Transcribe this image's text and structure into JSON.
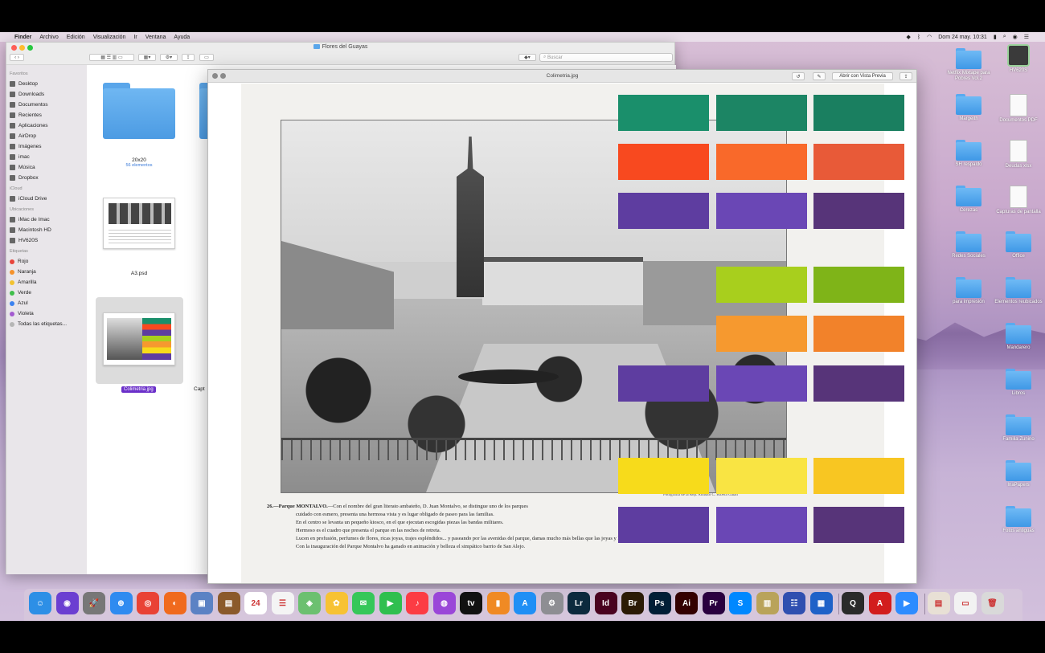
{
  "menubar": {
    "apple": "",
    "items": [
      "Finder",
      "Archivo",
      "Edición",
      "Visualización",
      "Ir",
      "Ventana",
      "Ayuda"
    ],
    "clock": "Dom 24 may.  10:31"
  },
  "finder": {
    "title": "Flores del Guayas",
    "search_placeholder": "Buscar",
    "sidebar": {
      "favorites_header": "Favoritos",
      "favorites": [
        "Desktop",
        "Downloads",
        "Documentos",
        "Recientes",
        "Aplicaciones",
        "AirDrop",
        "Imágenes",
        "imac",
        "Música",
        "Dropbox"
      ],
      "icloud_header": "iCloud",
      "icloud": [
        "iCloud Drive"
      ],
      "locations_header": "Ubicaciones",
      "locations": [
        "iMac de Imac",
        "Macintosh HD",
        "HV620S"
      ],
      "tags_header": "Etiquetas",
      "tags": [
        {
          "label": "Rojo",
          "color": "#e8453c"
        },
        {
          "label": "Naranja",
          "color": "#f5922b"
        },
        {
          "label": "Amarilla",
          "color": "#f2c230"
        },
        {
          "label": "Verde",
          "color": "#3fbe4b"
        },
        {
          "label": "Azul",
          "color": "#3a82f0"
        },
        {
          "label": "Violeta",
          "color": "#a35ad0"
        },
        {
          "label": "Todas las etiquetas...",
          "color": "#b5b5b5"
        }
      ]
    },
    "files": [
      {
        "name": "20x20",
        "sub": "56 elementos"
      },
      {
        "name": "A3.psd",
        "sub": ""
      },
      {
        "name": "Colimetria.jpg",
        "sub": ""
      },
      {
        "name": "Capt",
        "sub": ""
      }
    ]
  },
  "quicklook": {
    "title": "Colimetria.jpg",
    "open_with": "Abrir con Vista Previa",
    "caption": {
      "heading": "26.—Parque MONTALVO.",
      "line1": "—Con el nombre del gran literato ambateño, D. Juan Montalvo, se distingue uno de los parques",
      "line2": "cuidado con esmero, presenta una hermosa vista y es lugar obligado de paseo para las familias.",
      "line3": "En el centro se levanta un pequeño kiosco, en el que ejecutan escogidas piezas las bandas militares.",
      "line4": "Hermoso es el cuadro que presenta el parque en las noches de retreta.",
      "line5": "Lucen en profusión, perfumes de flores, ricas joyas, trajes espléndidos... y paseando por las avenidas del parque, damas mucho más bellas que las joyas y las flores.",
      "line6": "Con la inauguración del Parque Montalvo ha ganado en animación y belleza el simpático barrio de San Alejo."
    },
    "photo_credit": "Fotografía de la Rep. Ambato C. Ribera Galán",
    "swatches": [
      [
        "#1a8f6b",
        "#1c8564",
        "#1a7f60"
      ],
      [
        "#f8491f",
        "#f9692a",
        "#e85a38"
      ],
      [
        "#5e3da0",
        "#6a47b5",
        "#573479"
      ],
      [
        "",
        "#a8cf1d",
        "#7fb418"
      ],
      [
        "",
        "#f6992f",
        "#f2822a"
      ],
      [
        "#5e3da0",
        "#6a47b5",
        "#573479"
      ],
      [
        "#f7db1b",
        "#f9e443",
        "#f8c622"
      ],
      [
        "#5e3da0",
        "#6a47b5",
        "#573479"
      ]
    ]
  },
  "desktop_icons": [
    {
      "label": "Netflix Mixtape para Pobres Vol.2",
      "kind": "folder"
    },
    {
      "label": "HV620S",
      "kind": "drive"
    },
    {
      "label": "Margeith",
      "kind": "folder"
    },
    {
      "label": "Documentos PDF",
      "kind": "doc"
    },
    {
      "label": "SH respaldo",
      "kind": "folder"
    },
    {
      "label": "Deudas xlsx",
      "kind": "doc"
    },
    {
      "label": "Cerezas",
      "kind": "folder"
    },
    {
      "label": "Capturas de pantalla",
      "kind": "doc"
    },
    {
      "label": "Redes Sociales",
      "kind": "folder"
    },
    {
      "label": "Office",
      "kind": "folder"
    },
    {
      "label": "para impresión",
      "kind": "folder"
    },
    {
      "label": "Elementos reubicados",
      "kind": "folder"
    },
    {
      "label": "Mandarero",
      "kind": "folder"
    },
    {
      "label": "Libros",
      "kind": "folder"
    },
    {
      "label": "Familia Zunino",
      "kind": "folder"
    },
    {
      "label": "InaPapers",
      "kind": "folder"
    },
    {
      "label": "Fotos antiguas",
      "kind": "folder"
    }
  ],
  "dock": [
    {
      "name": "finder-icon",
      "glyph": "☺",
      "color": "#2d8fe6"
    },
    {
      "name": "siri-icon",
      "glyph": "◉",
      "color": "#6b3fd1"
    },
    {
      "name": "launchpad-icon",
      "glyph": "🚀",
      "color": "#777"
    },
    {
      "name": "safari-icon",
      "glyph": "⊕",
      "color": "#2f8bf0"
    },
    {
      "name": "chrome-icon",
      "glyph": "◎",
      "color": "#e94235"
    },
    {
      "name": "firefox-icon",
      "glyph": "◐",
      "color": "#f06a1d"
    },
    {
      "name": "preview-icon",
      "glyph": "▣",
      "color": "#5b82c4"
    },
    {
      "name": "notebook-icon",
      "glyph": "▤",
      "color": "#8b5a2b"
    },
    {
      "name": "calendar-icon",
      "glyph": "24",
      "color": "#ffffff"
    },
    {
      "name": "reminders-icon",
      "glyph": "☰",
      "color": "#f4f4f4"
    },
    {
      "name": "maps-icon",
      "glyph": "◈",
      "color": "#6cc070"
    },
    {
      "name": "photos-icon",
      "glyph": "✿",
      "color": "#f7c234"
    },
    {
      "name": "messages-icon",
      "glyph": "✉",
      "color": "#35c759"
    },
    {
      "name": "facetime-icon",
      "glyph": "▶",
      "color": "#2fbf4f"
    },
    {
      "name": "music-icon",
      "glyph": "♪",
      "color": "#fc3c44"
    },
    {
      "name": "podcasts-icon",
      "glyph": "◍",
      "color": "#9a47d8"
    },
    {
      "name": "appletv-icon",
      "glyph": "tv",
      "color": "#111111"
    },
    {
      "name": "books-icon",
      "glyph": "▮",
      "color": "#f08a24"
    },
    {
      "name": "appstore-icon",
      "glyph": "A",
      "color": "#1f8ff5"
    },
    {
      "name": "system-preferences-icon",
      "glyph": "⚙",
      "color": "#8e8e93"
    },
    {
      "name": "lightroom-icon",
      "glyph": "Lr",
      "color": "#0c2a3d"
    },
    {
      "name": "indesign-icon",
      "glyph": "Id",
      "color": "#49021f"
    },
    {
      "name": "bridge-icon",
      "glyph": "Br",
      "color": "#2b1a05"
    },
    {
      "name": "photoshop-icon",
      "glyph": "Ps",
      "color": "#001e36"
    },
    {
      "name": "illustrator-icon",
      "glyph": "Ai",
      "color": "#330000"
    },
    {
      "name": "premiere-icon",
      "glyph": "Pr",
      "color": "#2a003f"
    },
    {
      "name": "shazam-icon",
      "glyph": "S",
      "color": "#0088ff"
    },
    {
      "name": "archive-utility-icon",
      "glyph": "▥",
      "color": "#b9a35a"
    },
    {
      "name": "user-manager-icon",
      "glyph": "☷",
      "color": "#2f4fb0"
    },
    {
      "name": "screen-tool-icon",
      "glyph": "▦",
      "color": "#1f62c8"
    },
    {
      "name": "quicktime-icon",
      "glyph": "Q",
      "color": "#2a2a2a"
    },
    {
      "name": "acrobat-icon",
      "glyph": "A",
      "color": "#d21d1d"
    },
    {
      "name": "zoom-icon",
      "glyph": "▶",
      "color": "#2d8cff"
    },
    {
      "name": "downloads-stack-icon",
      "glyph": "▤",
      "color": "#e8e0d5"
    },
    {
      "name": "documents-stack-icon",
      "glyph": "▭",
      "color": "#f2f2f2"
    },
    {
      "name": "trash-icon",
      "glyph": "🗑",
      "color": "#d9d9d9"
    }
  ]
}
